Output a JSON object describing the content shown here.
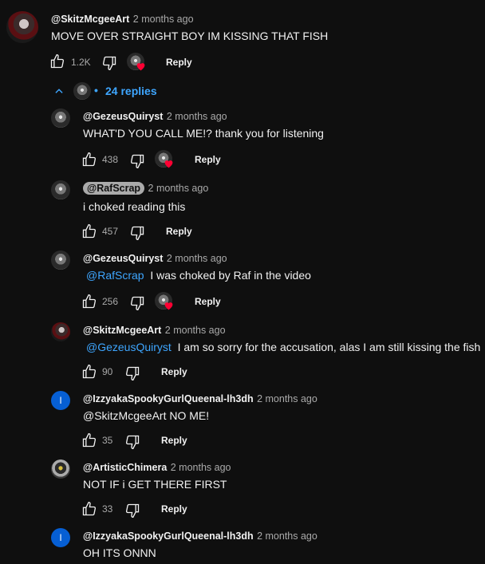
{
  "top": {
    "author": "@SkitzMcgeeArt",
    "time": "2 months ago",
    "text": "MOVE OVER STRAIGHT BOY IM KISSING THAT FISH",
    "likes": "1.2K",
    "reply_label": "Reply",
    "replies_label": "24 replies"
  },
  "replies": [
    {
      "author": "@GezeusQuiryst",
      "time": "2 months ago",
      "text": "WHAT'D YOU CALL ME!? thank you for listening",
      "likes": "438",
      "reply_label": "Reply"
    },
    {
      "author": "@RafScrap",
      "time": "2 months ago",
      "text": "i choked reading this",
      "likes": "457",
      "reply_label": "Reply"
    },
    {
      "author": "@GezeusQuiryst",
      "time": "2 months ago",
      "mention": "@RafScrap",
      "text": "I was choked by Raf in the video",
      "likes": "256",
      "reply_label": "Reply"
    },
    {
      "author": "@SkitzMcgeeArt",
      "time": "2 months ago",
      "mention": "@GezeusQuiryst",
      "text": "I am so sorry for the accusation, alas I am still kissing the fish",
      "likes": "90",
      "reply_label": "Reply"
    },
    {
      "author": "@IzzyakaSpookyGurlQueenal-lh3dh",
      "time": "2 months ago",
      "avatar_letter": "I",
      "text": "@SkitzMcgeeArt  NO ME!",
      "likes": "35",
      "reply_label": "Reply"
    },
    {
      "author": "@ArtisticChimera",
      "time": "2 months ago",
      "text": "NOT IF i GET THERE FIRST",
      "likes": "33",
      "reply_label": "Reply"
    },
    {
      "author": "@IzzyakaSpookyGurlQueenal-lh3dh",
      "time": "2 months ago",
      "avatar_letter": "I",
      "text": "OH ITS ONNN"
    }
  ],
  "colors": {
    "accent": "#3ea6ff",
    "heart": "#ff0033",
    "background": "#0f0f0f"
  }
}
